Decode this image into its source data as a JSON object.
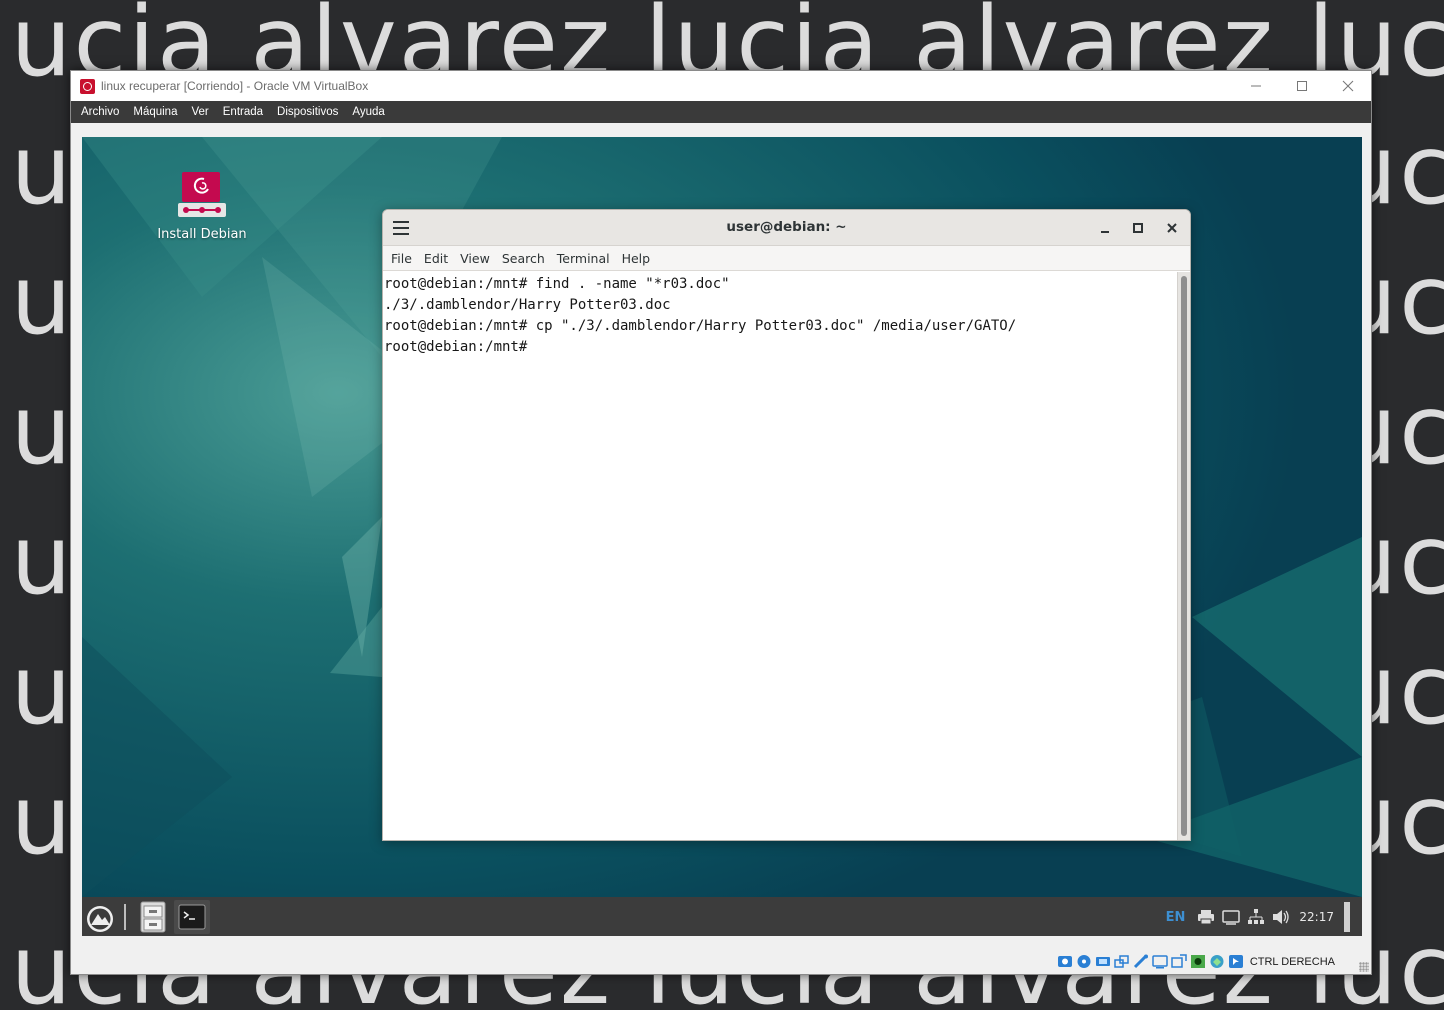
{
  "wallpaper": {
    "text": "lucia alvarez lucia alvarez lucia alvarez lucia alvarez"
  },
  "vbox": {
    "title": "linux recuperar [Corriendo] - Oracle VM VirtualBox",
    "controls": {
      "minimize": "—",
      "maximize": "☐",
      "close": "✕"
    },
    "menu": [
      "Archivo",
      "Máquina",
      "Ver",
      "Entrada",
      "Dispositivos",
      "Ayuda"
    ],
    "status": {
      "host_key": "CTRL DERECHA",
      "icons": [
        "hard-disk-icon",
        "optical-disk-icon",
        "audio-icon",
        "network-icon",
        "usb-icon",
        "shared-folders-icon",
        "display-icon",
        "recording-icon",
        "cpu-activity-icon",
        "mouse-integration-icon",
        "keyboard-icon"
      ]
    }
  },
  "desktop": {
    "icon_label": "Install Debian",
    "accent": "#0b5460"
  },
  "terminal": {
    "title": "user@debian: ~",
    "menu": [
      "File",
      "Edit",
      "View",
      "Search",
      "Terminal",
      "Help"
    ],
    "lines": [
      "root@debian:/mnt# find . -name \"*r03.doc\"",
      "./3/.damblendor/Harry Potter03.doc",
      "root@debian:/mnt# cp \"./3/.damblendor/Harry Potter03.doc\" /media/user/GATO/",
      "root@debian:/mnt# "
    ]
  },
  "panel": {
    "lang": "EN",
    "clock": "22:17",
    "accent": "#3d8fd1"
  }
}
